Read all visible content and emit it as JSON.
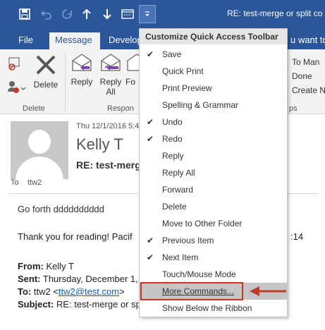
{
  "window": {
    "title": "RE: test-merge or split co"
  },
  "qat": {
    "buttons": [
      "save-icon",
      "undo-icon",
      "redo-icon",
      "previous-item-icon",
      "next-item-icon",
      "touch-mode-icon",
      "customize-dropdown-icon"
    ]
  },
  "tabs": [
    {
      "label": "File"
    },
    {
      "label": "Message"
    },
    {
      "label": "Develop"
    },
    {
      "label": "u want to"
    }
  ],
  "ribbon": {
    "delete_label": "Delete",
    "reply_label": "Reply",
    "reply_all_line1": "Reply",
    "reply_all_line2": "All",
    "forward_partial": "Fo",
    "group_delete": "Delete",
    "group_respond": "Respon",
    "group_steps": "ps",
    "side_items": [
      "To Man",
      "Done",
      "Create N"
    ]
  },
  "email": {
    "date": "Thu 12/1/2016 5:4",
    "sender": "Kelly T",
    "subject": "RE: test-merge",
    "to_label": "To",
    "to_value": "ttw2",
    "body_line1": "Go forth dddddddddd",
    "body_line2": "Thank you for reading!  Pacif",
    "body_line2_end": ":14",
    "from_label": "From:",
    "from_value": "Kelly T",
    "sent_label": "Sent:",
    "sent_value": "Thursday, December 1,",
    "to2_label": "To:",
    "to2_value": "ttw2 <",
    "to2_link": "ttw2@test.com",
    "to2_end": ">",
    "subject_label": "Subject:",
    "subject_value": "RE: test-merge or sp"
  },
  "menu": {
    "header": "Customize Quick Access Toolbar",
    "items": [
      {
        "label": "Save",
        "checked": true
      },
      {
        "label": "Quick Print",
        "checked": false
      },
      {
        "label": "Print Preview",
        "checked": false
      },
      {
        "label": "Spelling & Grammar",
        "checked": false
      },
      {
        "label": "Undo",
        "checked": true
      },
      {
        "label": "Redo",
        "checked": true
      },
      {
        "label": "Reply",
        "checked": false
      },
      {
        "label": "Reply All",
        "checked": false
      },
      {
        "label": "Forward",
        "checked": false
      },
      {
        "label": "Delete",
        "checked": false
      },
      {
        "label": "Move to Other Folder",
        "checked": false
      },
      {
        "label": "Previous Item",
        "checked": true
      },
      {
        "label": "Next Item",
        "checked": true
      },
      {
        "label": "Touch/Mouse Mode",
        "checked": false
      },
      {
        "label": "More Commands...",
        "checked": false,
        "hover": true
      },
      {
        "label": "Show Below the Ribbon",
        "checked": false
      }
    ],
    "check_glyph": "✔"
  },
  "colors": {
    "accent": "#2b579a",
    "highlight": "#c0392b",
    "arrow_accent": "#7e3fb5"
  }
}
